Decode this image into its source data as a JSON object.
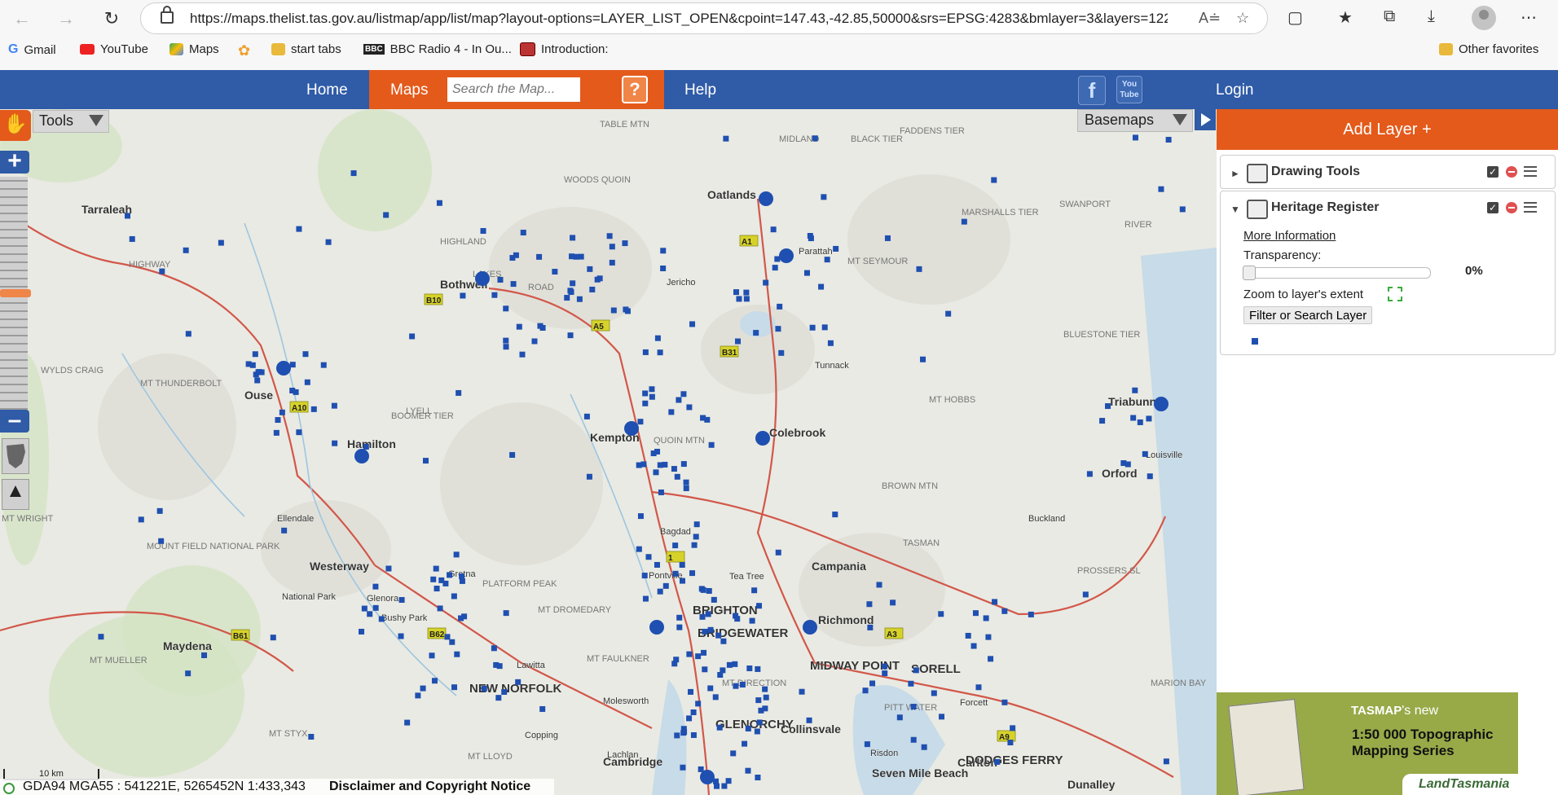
{
  "browser": {
    "url": "https://maps.thelist.tas.gov.au/listmap/app/list/map?layout-options=LAYER_LIST_OPEN&cpoint=147.43,-42.85,50000&srs=EPSG:4283&bmlayer=3&layers=122",
    "bookmarks": [
      {
        "label": "Gmail",
        "icon": "gmail-icon"
      },
      {
        "label": "YouTube",
        "icon": "youtube-icon"
      },
      {
        "label": "Maps",
        "icon": "maps-icon"
      },
      {
        "label": "",
        "icon": "flower-icon"
      },
      {
        "label": "start tabs",
        "icon": "folder-icon"
      },
      {
        "label": "BBC Radio 4 - In Ou...",
        "icon": "bbc-icon"
      },
      {
        "label": "Introduction:",
        "icon": "book-icon"
      }
    ],
    "other_favorites": "Other favorites"
  },
  "site": {
    "nav": {
      "home": "Home",
      "maps": "Maps",
      "help": "Help",
      "login": "Login"
    },
    "search_placeholder": "Search the Map...",
    "help_icon": "?",
    "social": {
      "facebook": "f",
      "youtube": "You Tube"
    }
  },
  "map": {
    "tools_label": "Tools",
    "basemaps_label": "Basemaps",
    "scale_label": "10 km",
    "coords": "GDA94 MGA55 : 541221E, 5265452N 1:433,343",
    "disclaimer": "Disclaimer and Copyright Notice",
    "places": [
      {
        "name": "Tarraleah",
        "size": "m"
      },
      {
        "name": "Bothwell",
        "size": "m"
      },
      {
        "name": "Oatlands",
        "size": "m"
      },
      {
        "name": "Parattah",
        "size": "s"
      },
      {
        "name": "Jericho",
        "size": "s"
      },
      {
        "name": "Ouse",
        "size": "m"
      },
      {
        "name": "Hamilton",
        "size": "m"
      },
      {
        "name": "Kempton",
        "size": "m"
      },
      {
        "name": "Colebrook",
        "size": "m"
      },
      {
        "name": "Tunnack",
        "size": "s"
      },
      {
        "name": "Triabunna",
        "size": "m"
      },
      {
        "name": "Louisville",
        "size": "s"
      },
      {
        "name": "Orford",
        "size": "m"
      },
      {
        "name": "Buckland",
        "size": "s"
      },
      {
        "name": "Ellendale",
        "size": "s"
      },
      {
        "name": "Westerway",
        "size": "m"
      },
      {
        "name": "Gretna",
        "size": "s"
      },
      {
        "name": "National Park",
        "size": "s"
      },
      {
        "name": "Glenora",
        "size": "s"
      },
      {
        "name": "Bushy Park",
        "size": "s"
      },
      {
        "name": "Bagdad",
        "size": "s"
      },
      {
        "name": "Pontville",
        "size": "s"
      },
      {
        "name": "Tea Tree",
        "size": "s"
      },
      {
        "name": "Campania",
        "size": "m"
      },
      {
        "name": "BRIGHTON",
        "size": "l"
      },
      {
        "name": "BRIDGEWATER",
        "size": "l"
      },
      {
        "name": "Richmond",
        "size": "m"
      },
      {
        "name": "Maydena",
        "size": "m"
      },
      {
        "name": "Lawitta",
        "size": "s"
      },
      {
        "name": "NEW NORFOLK",
        "size": "l"
      },
      {
        "name": "Molesworth",
        "size": "s"
      },
      {
        "name": "MIDWAY POINT",
        "size": "l"
      },
      {
        "name": "SORELL",
        "size": "l"
      },
      {
        "name": "Forcett",
        "size": "s"
      },
      {
        "name": "Copping",
        "size": "s"
      },
      {
        "name": "Lachlan",
        "size": "s"
      },
      {
        "name": "GLENORCHY",
        "size": "l"
      },
      {
        "name": "Collinsvale",
        "size": "m"
      },
      {
        "name": "Risdon",
        "size": "s"
      },
      {
        "name": "Cambridge",
        "size": "m"
      },
      {
        "name": "Seven Mile Beach",
        "size": "m"
      },
      {
        "name": "Carlton",
        "size": "m"
      },
      {
        "name": "DODGES FERRY",
        "size": "l"
      },
      {
        "name": "Dunalley",
        "size": "m"
      }
    ],
    "features": [
      "TABLE MTN",
      "WOODS QUOIN",
      "MIDLAND",
      "FADDENS TIER",
      "BLACK TIER",
      "MT SEYMOUR",
      "MARSHALLS TIER",
      "SWANPORT",
      "RIVER",
      "WYLDS CRAIG",
      "MT THUNDERBOLT",
      "BOOMER TIER",
      "QUOIN MTN",
      "MT HOBBS",
      "BLUESTONE TIER",
      "BROWN MTN",
      "TASMAN",
      "PROSSERS SL",
      "MOUNT FIELD NATIONAL PARK",
      "PLATFORM PEAK",
      "MT DROMEDARY",
      "MT FAULKNER",
      "MT DIRECTION",
      "MARION BAY",
      "PITT WATER",
      "MT MUELLER",
      "MT STYX",
      "MT LLOYD",
      "MT WRIGHT",
      "HIGHWAY",
      "ROAD",
      "LYELL",
      "HIGHLAND",
      "LAKES"
    ],
    "road_shields": [
      "A5",
      "A10",
      "B31",
      "A3",
      "A9",
      "B61",
      "B62",
      "B10",
      "A1",
      "1"
    ]
  },
  "panel": {
    "add_layer": "Add Layer +",
    "layers": [
      {
        "title": "Drawing Tools",
        "expanded": false,
        "checked": true
      },
      {
        "title": "Heritage Register",
        "expanded": true,
        "checked": true
      }
    ],
    "heritage": {
      "more_info": "More Information",
      "transparency_label": "Transparency:",
      "transparency_value": "0%",
      "transparency": 0,
      "zoom_extent": "Zoom to layer's extent",
      "filter_button": "Filter or Search Layer"
    }
  },
  "ad": {
    "brand": "TASMAP",
    "brand_suffix": "'s new",
    "line1": "1:50 000 Topographic",
    "line2": "Mapping Series",
    "publisher": "LandTasmania"
  },
  "colors": {
    "header_blue": "#2f5ba7",
    "accent_orange": "#e45a1b",
    "heritage_marker": "#1f4fb0"
  }
}
